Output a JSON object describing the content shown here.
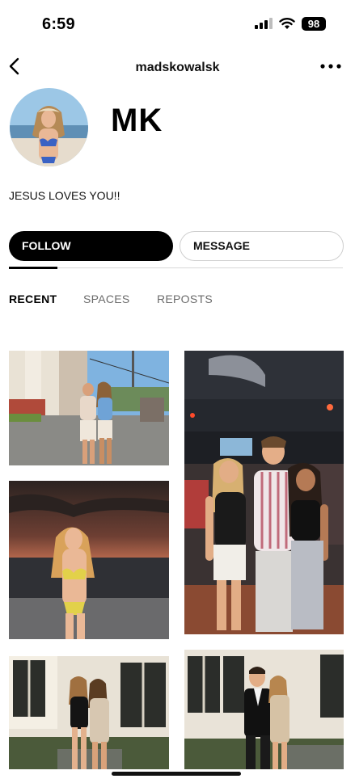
{
  "status_bar": {
    "time": "6:59",
    "battery": "98",
    "icons": [
      "signal-icon",
      "wifi-icon",
      "battery-icon"
    ]
  },
  "nav": {
    "title": "madskowalsk",
    "back_icon": "chevron-left-icon",
    "more_icon": "more-horizontal-icon"
  },
  "profile": {
    "name": "MK",
    "bio": "JESUS LOVES YOU!!"
  },
  "actions": {
    "follow_label": "FOLLOW",
    "message_label": "MESSAGE"
  },
  "tabs": [
    {
      "label": "RECENT",
      "active": true
    },
    {
      "label": "SPACES",
      "active": false
    },
    {
      "label": "REPOSTS",
      "active": false
    }
  ],
  "colors": {
    "primary": "#000000",
    "inactive_tab": "#6b6b6b",
    "divider": "#d8d8d8"
  }
}
